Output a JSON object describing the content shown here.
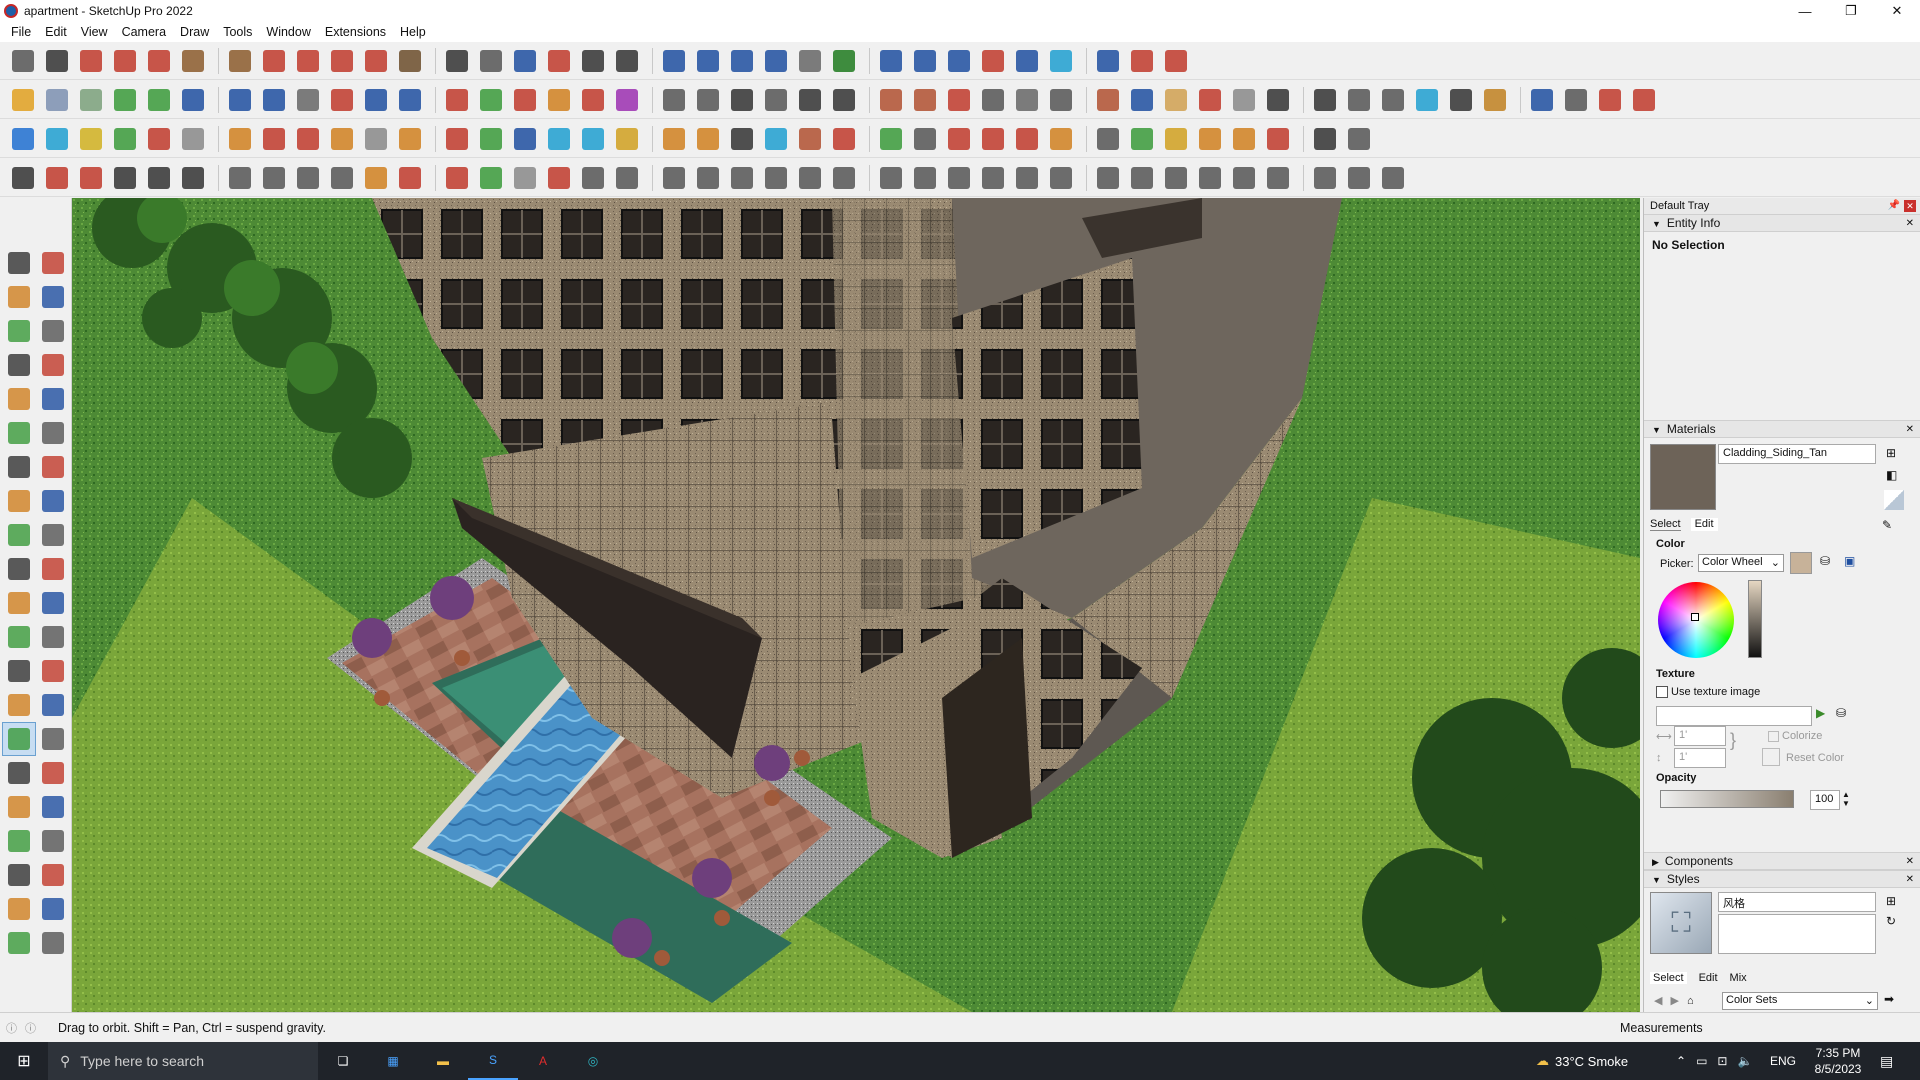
{
  "window": {
    "title": "apartment - SketchUp Pro 2022",
    "min_label": "—",
    "max_label": "❐",
    "close_label": "✕"
  },
  "menu": [
    "File",
    "Edit",
    "View",
    "Camera",
    "Draw",
    "Tools",
    "Window",
    "Extensions",
    "Help"
  ],
  "toolbar_colors": {
    "row1": [
      "#555",
      "#333",
      "#c0392b",
      "#c0392b",
      "#c0392b",
      "#8b5a2b",
      "#8b5a2b",
      "#c0392b",
      "#c0392b",
      "#c0392b",
      "#c0392b",
      "#6b4c2a",
      "#333",
      "#555",
      "#1f4fa0",
      "#c0392b",
      "#333",
      "#333",
      "#1f4fa0",
      "#1f4fa0",
      "#1f4fa0",
      "#1f4fa0",
      "#666",
      "#1f7a1f",
      "#1f4fa0",
      "#1f4fa0",
      "#1f4fa0",
      "#c0392b",
      "#1f4fa0",
      "#1f9fd0",
      "#1f4fa0",
      "#c0392b",
      "#c0392b"
    ],
    "row2": [
      "#e0a020",
      "#7b8fb0",
      "#7aa07a",
      "#3a9a3a",
      "#3a9a3a",
      "#1f4fa0",
      "#1f4fa0",
      "#1f4fa0",
      "#666",
      "#c0392b",
      "#1f4fa0",
      "#1f4fa0",
      "#c0392b",
      "#3a9a3a",
      "#c0392b",
      "#d08020",
      "#c0392b",
      "#9b2fb0",
      "#555",
      "#555",
      "#333",
      "#555",
      "#333",
      "#333",
      "#b05030",
      "#b05030",
      "#c0392b",
      "#555",
      "#666",
      "#555",
      "#b05030",
      "#1f4fa0",
      "#d0a050",
      "#c0392b",
      "#888",
      "#333",
      "#333",
      "#555",
      "#555",
      "#1f9fd0",
      "#333",
      "#c08020",
      "#1f4fa0",
      "#555",
      "#c0392b",
      "#c0392b"
    ],
    "row3": [
      "#1f6fd0",
      "#1f9fd0",
      "#d0b020",
      "#3a9a3a",
      "#c0392b",
      "#888",
      "#d08020",
      "#c0392b",
      "#c0392b",
      "#d08020",
      "#888",
      "#d08020",
      "#c0392b",
      "#3a9a3a",
      "#1f4fa0",
      "#1f9fd0",
      "#1f9fd0",
      "#d0a020",
      "#d08020",
      "#d08020",
      "#333",
      "#1f9fd0",
      "#b05030",
      "#c0392b",
      "#3a9a3a",
      "#555",
      "#c0392b",
      "#c0392b",
      "#c0392b",
      "#d08020",
      "#555",
      "#3a9a3a",
      "#d0a020",
      "#d08020",
      "#d08020",
      "#c0392b",
      "#333",
      "#555"
    ],
    "row4": [
      "#333",
      "#c0392b",
      "#c0392b",
      "#333",
      "#333",
      "#333",
      "#555",
      "#555",
      "#555",
      "#555",
      "#d08020",
      "#c0392b",
      "#c0392b",
      "#3a9a3a",
      "#888",
      "#c0392b",
      "#555",
      "#555",
      "#555",
      "#555",
      "#555",
      "#555",
      "#555",
      "#555",
      "#555",
      "#555",
      "#555",
      "#555",
      "#555",
      "#555",
      "#555",
      "#555",
      "#555",
      "#555",
      "#555",
      "#555",
      "#555",
      "#555",
      "#555"
    ]
  },
  "left_toolbar": [
    "select-icon",
    "orbit-icon",
    "paint-bucket-icon",
    "eraser-icon",
    "tape-icon",
    "pencil-icon",
    "line-icon",
    "freehand-icon",
    "rectangle-icon",
    "rotated-rectangle-icon",
    "circle-icon",
    "polygon-icon",
    "arc-icon",
    "pie-icon",
    "2pt-arc-icon",
    "3pt-arc-icon",
    "move-icon",
    "push-pull-icon",
    "rotate-icon",
    "follow-me-icon",
    "scale-icon",
    "offset-icon",
    "tape-measure-icon",
    "dimension-icon",
    "protractor-icon",
    "text-icon",
    "axes-icon",
    "3d-text-icon",
    "orbit-active-icon",
    "pan-icon",
    "zoom-icon",
    "zoom-window-icon",
    "zoom-extents-icon",
    "previous-icon",
    "position-camera-icon",
    "look-around-icon",
    "walk-icon",
    "section-plane-icon",
    "component-icon",
    "sandbox-icon",
    "layer-icon",
    "outliner-icon"
  ],
  "tray": {
    "title": "Default Tray",
    "entity_info": {
      "header": "Entity Info",
      "value": "No Selection"
    },
    "materials": {
      "header": "Materials",
      "name": "Cladding_Siding_Tan",
      "tab_select": "Select",
      "tab_edit": "Edit",
      "color_label": "Color",
      "picker_label": "Picker:",
      "picker_value": "Color Wheel",
      "texture_label": "Texture",
      "use_texture_label": "Use texture image",
      "width_value": "1'",
      "height_value": "1'",
      "colorize_label": "Colorize",
      "reset_color_label": "Reset Color",
      "opacity_label": "Opacity",
      "opacity_value": "100",
      "swatch_color": "#6d6358",
      "sample_color": "#c7b299"
    },
    "components": {
      "header": "Components"
    },
    "styles": {
      "header": "Styles",
      "name": "风格",
      "tab_select": "Select",
      "tab_edit": "Edit",
      "tab_mix": "Mix",
      "collection": "Color Sets"
    }
  },
  "status": {
    "hint": "Drag to orbit. Shift = Pan, Ctrl = suspend gravity.",
    "measurements_label": "Measurements"
  },
  "taskbar": {
    "search_placeholder": "Type here to search",
    "weather": "33°C Smoke",
    "lang": "ENG",
    "time": "7:35 PM",
    "date": "8/5/2023"
  }
}
